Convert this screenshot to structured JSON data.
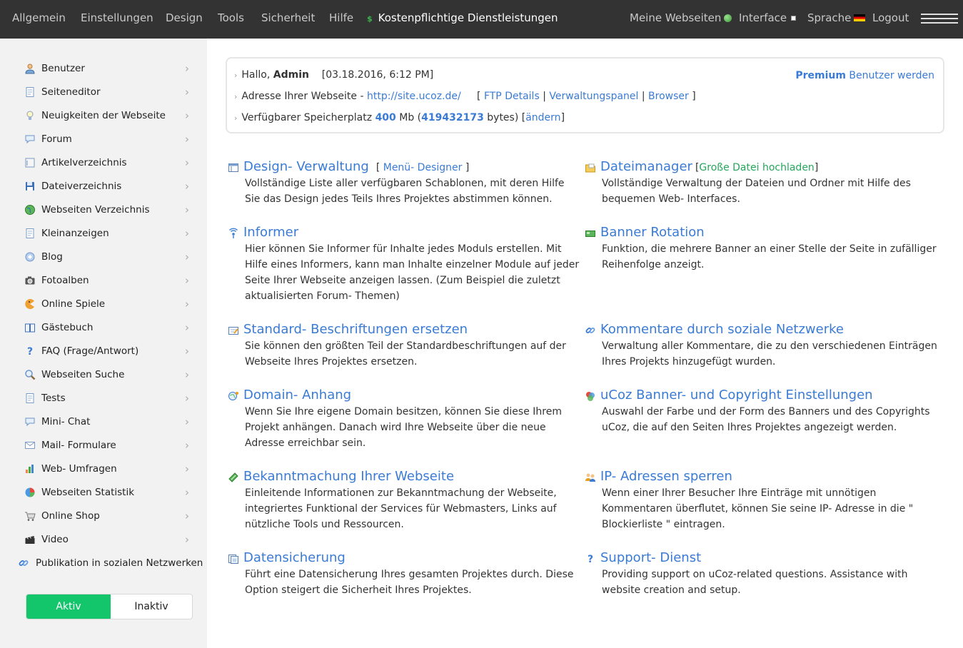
{
  "nav": {
    "left": [
      "Allgemein",
      "Einstellungen",
      "Design",
      "Tools",
      "Sicherheit",
      "Hilfe"
    ],
    "paid_icon": "$",
    "paid": "Kostenpflichtige Dienstleistungen",
    "my_sites": "Meine Webseiten",
    "interface": "Interface",
    "language": "Sprache",
    "logout": "Logout"
  },
  "sidebar": {
    "items": [
      {
        "label": "Benutzer",
        "icon": "user-icon"
      },
      {
        "label": "Seiteneditor",
        "icon": "page-icon"
      },
      {
        "label": "Neuigkeiten der Webseite",
        "icon": "bulb-icon"
      },
      {
        "label": "Forum",
        "icon": "chat-bubble-icon"
      },
      {
        "label": "Artikelverzeichnis",
        "icon": "article-icon"
      },
      {
        "label": "Dateiverzeichnis",
        "icon": "floppy-icon"
      },
      {
        "label": "Webseiten Verzeichnis",
        "icon": "globe-icon"
      },
      {
        "label": "Kleinanzeigen",
        "icon": "page-icon"
      },
      {
        "label": "Blog",
        "icon": "gear-icon"
      },
      {
        "label": "Fotoalben",
        "icon": "camera-icon"
      },
      {
        "label": "Online Spiele",
        "icon": "pacman-icon"
      },
      {
        "label": "Gästebuch",
        "icon": "book-icon"
      },
      {
        "label": "FAQ (Frage/Antwort)",
        "icon": "question-icon"
      },
      {
        "label": "Webseiten Suche",
        "icon": "magnifier-icon"
      },
      {
        "label": "Tests",
        "icon": "page-icon"
      },
      {
        "label": "Mini- Chat",
        "icon": "chat-bubble-icon"
      },
      {
        "label": "Mail- Formulare",
        "icon": "envelope-icon"
      },
      {
        "label": "Web- Umfragen",
        "icon": "bar-chart-icon"
      },
      {
        "label": "Webseiten Statistik",
        "icon": "pie-chart-icon"
      },
      {
        "label": "Online Shop",
        "icon": "cart-icon"
      },
      {
        "label": "Video",
        "icon": "clapper-icon"
      },
      {
        "label": "Publikation in sozialen Netzwerken",
        "icon": "link-icon"
      }
    ],
    "chevron": "›",
    "toggle_on": "Aktiv",
    "toggle_off": "Inaktiv"
  },
  "info": {
    "greeting": "Hallo,",
    "user": "Admin",
    "datetime": "[03.18.2016, 6:12 PM]",
    "address_label": "Adresse Ihrer Webseite -",
    "address_url": "http://site.ucoz.de/",
    "bracket_open": "[",
    "ftp": "FTP Details",
    "sep": "|",
    "panel": "Verwaltungspanel",
    "browser": "Browser",
    "bracket_close": "]",
    "storage_label": "Verfügbarer Speicherplatz",
    "storage_mb": "400",
    "storage_mb_unit": "Mb (",
    "storage_bytes": "419432173",
    "storage_bytes_unit": "bytes) [",
    "change": "ändern",
    "storage_end": "]",
    "premium_bold": "Premium",
    "premium_rest": "Benutzer werden"
  },
  "tools": [
    {
      "title": "Design- Verwaltung",
      "sub_open": "[",
      "sub": "Menü- Designer",
      "sub_close": "]",
      "desc": "Vollständige Liste aller verfügbaren Schablonen, mit deren Hilfe Sie das Design jedes Teils Ihres Projektes abstimmen können.",
      "icon": "layout-icon"
    },
    {
      "title": "Dateimanager",
      "sub_open": "[",
      "sub": "Große Datei hochladen",
      "sub_close": "]",
      "desc": "Vollständige Verwaltung der Dateien und Ordner mit Hilfe des bequemen Web- Interfaces.",
      "icon": "folder-icon"
    },
    {
      "title": "Informer",
      "desc": "Hier können Sie Informer für Inhalte jedes Moduls erstellen. Mit Hilfe eines Informers, kann man Inhalte einzelner Module auf jeder Seite Ihrer Webseite anzeigen lassen. (Zum Beispiel die zuletzt aktualisierten Forum- Themen)",
      "icon": "broadcast-icon"
    },
    {
      "title": "Banner Rotation",
      "desc": "Funktion, die mehrere Banner an einer Stelle der Seite in zufälliger Reihenfolge anzeigt.",
      "icon": "banner-icon"
    },
    {
      "title": "Standard- Beschriftungen ersetzen",
      "desc": "Sie können den größten Teil der Standardbeschriftungen auf der Webseite Ihres Projektes ersetzen.",
      "icon": "edit-icon"
    },
    {
      "title": "Kommentare durch soziale Netzwerke",
      "desc": "Verwaltung aller Kommentare, die zu den verschiedenen Einträgen Ihres Projekts hinzugefügt wurden.",
      "icon": "link-icon"
    },
    {
      "title": "Domain- Anhang",
      "desc": "Wenn Sie Ihre eigene Domain besitzen, können Sie diese Ihrem Projekt anhängen. Danach wird Ihre Webseite über die neue Adresse erreichbar sein.",
      "icon": "domain-icon"
    },
    {
      "title": "uCoz Banner- und Copyright Einstellungen",
      "desc": "Auswahl der Farbe und der Form des Banners und des Copyrights uCoz, die auf den Seiten Ihres Projektes angezeigt werden.",
      "icon": "palette-icon"
    },
    {
      "title": "Bekanntmachung Ihrer Webseite",
      "desc": "Einleitende Informationen zur Bekanntmachung der Webseite, integriertes Funktional der Services für Webmasters, Links auf nützliche Tools und Ressourcen.",
      "icon": "promo-icon"
    },
    {
      "title": "IP- Adressen sperren",
      "desc": "Wenn einer Ihrer Besucher Ihre Einträge mit unnötigen Kommentaren überflutet, können Sie seine IP- Adresse in die \" Blockierliste \" eintragen.",
      "icon": "users-block-icon"
    },
    {
      "title": "Datensicherung",
      "desc": "Führt eine Datensicherung Ihres gesamten Projektes durch. Diese Option steigert die Sicherheit Ihres Projektes.",
      "icon": "backup-icon"
    },
    {
      "title": "Support- Dienst",
      "desc": "Providing support on uCoz-related questions. Assistance with website creation and setup.",
      "icon": "question-icon"
    }
  ]
}
